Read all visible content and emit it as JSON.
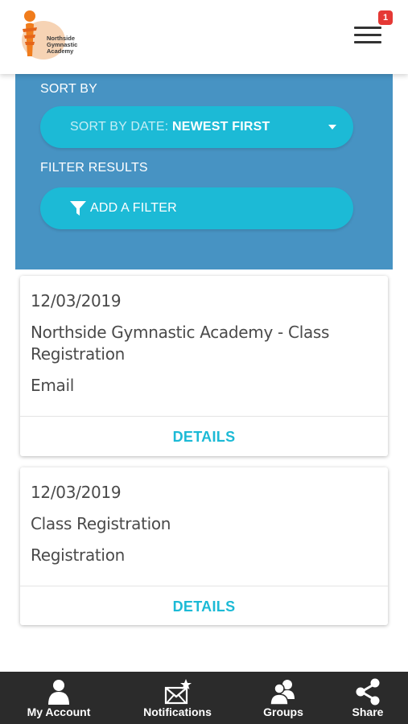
{
  "header": {
    "logo_text": "Northside Gymnastic Academy",
    "menu_icon": "hamburger-menu-icon",
    "notification_count": "1"
  },
  "filters": {
    "sort_label": "SORT BY",
    "sort_prefix": "SORT BY DATE: ",
    "sort_value": "NEWEST FIRST",
    "filter_label": "FILTER RESULTS",
    "add_filter": "ADD A FILTER"
  },
  "cards": [
    {
      "date": "12/03/2019",
      "title": "Northside Gymnastic Academy - Class Registration",
      "type": "Email",
      "action": "DETAILS"
    },
    {
      "date": "12/03/2019",
      "title": "Class Registration",
      "type": "Registration",
      "action": "DETAILS"
    }
  ],
  "bottom_nav": {
    "items": [
      {
        "label": "My Account",
        "icon": "user-icon"
      },
      {
        "label": "Notifications",
        "icon": "envelope-star-icon"
      },
      {
        "label": "Groups",
        "icon": "group-icon"
      },
      {
        "label": "Share",
        "icon": "share-icon"
      }
    ]
  },
  "colors": {
    "panel_bg": "#4793c3",
    "accent": "#1cbad6",
    "badge": "#e53935",
    "nav_bg": "#2b2b2b"
  }
}
